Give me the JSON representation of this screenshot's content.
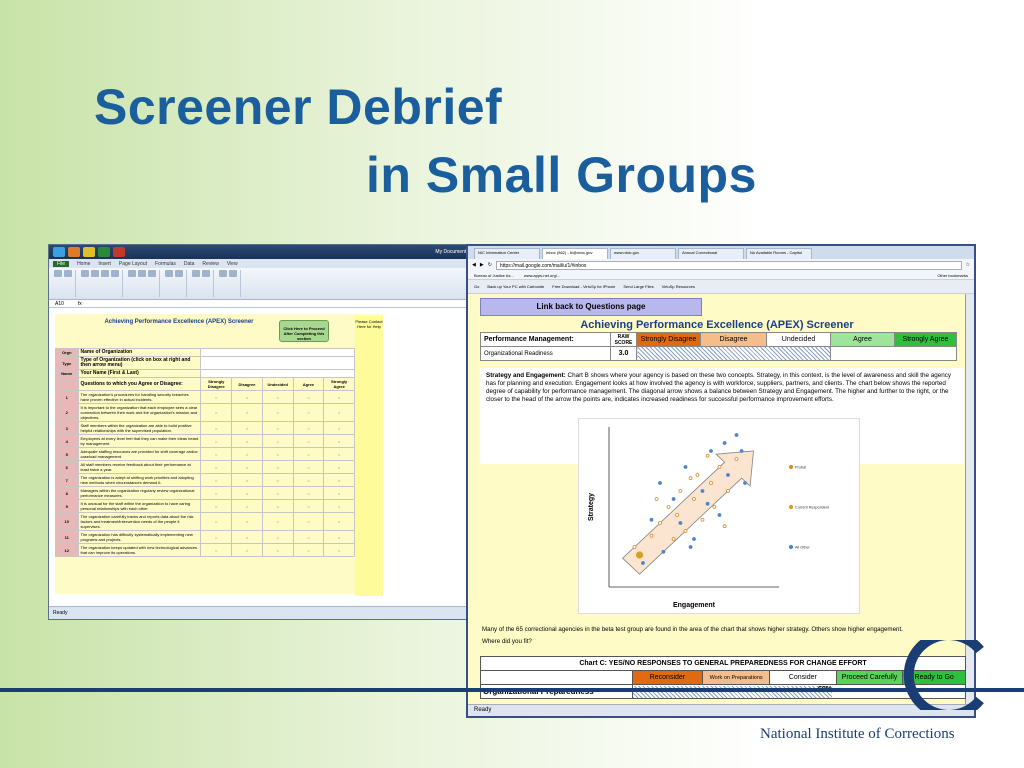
{
  "slide": {
    "title_line1": "Screener Debrief",
    "title_line2": "in Small Groups",
    "org_name": "National Institute of Corrections"
  },
  "excel": {
    "taskbar_text": "My Documents  NIC Apps  8:22 AM",
    "tabs": [
      "File",
      "Home",
      "Insert",
      "Page Layout",
      "Formulas",
      "Data",
      "Review",
      "View"
    ],
    "cell_ref": "A10",
    "headline": "Achieving Performance Excellence (APEX) Screener",
    "proceed_button": "Click Here to Proceed After Completing this section",
    "side_note": "Please Contact Here for Help",
    "info_rows": [
      {
        "code": "Orgn",
        "label": "Name of Organization"
      },
      {
        "code": "Type",
        "label": "Type of Organization (click on box at right and then arrow menu)"
      },
      {
        "code": "Name",
        "label": "Your Name (First & Last)"
      }
    ],
    "question_header": "Questions to which you Agree or Disagree:",
    "scale": [
      "Strongly Disagree",
      "Disagree",
      "Undecided",
      "Agree",
      "Strongly Agree"
    ],
    "questions": [
      {
        "n": "1",
        "text": "The organization's procedures for handling security breaches have proven effective in actual incidents."
      },
      {
        "n": "2",
        "text": "It is important to the organization that each employee sees a clear connection between their work and the organization's mission and objectives."
      },
      {
        "n": "3",
        "text": "Staff members within the organization are able to build positive helpful relationships with the supervised population."
      },
      {
        "n": "4",
        "text": "Employees at every level feel that they can make their ideas heard by management."
      },
      {
        "n": "5",
        "text": "Adequate staffing resources are provided for shift coverage and/or caseload management."
      },
      {
        "n": "6",
        "text": "All staff members receive feedback about their performance at least twice a year."
      },
      {
        "n": "7",
        "text": "The organization is adept at shifting work priorities and adopting new methods when circumstances demand it."
      },
      {
        "n": "8",
        "text": "Managers within the organization regularly review organizational performance measures."
      },
      {
        "n": "9",
        "text": "It is unusual for the staff within the organization to have caring personal relationships with each other."
      },
      {
        "n": "10",
        "text": "The organization carefully tracks and reports data about the risk factors and treatment/intervention needs of the people it supervises."
      },
      {
        "n": "11",
        "text": "The organization has difficulty systematically implementing new programs and projects."
      },
      {
        "n": "12",
        "text": "The organization keeps updated with new technological advances that can improve its operations."
      }
    ],
    "status": "Ready"
  },
  "browser": {
    "tabs": [
      "NIC Information Center",
      "Inbox (862) - lb@nicic.gov",
      "www.nicic.gov",
      "Annual Correctional",
      "No Available Rooms - Capitol"
    ],
    "url": "https://mail.google.com/mail/u/1/#inbox",
    "bookmarks": [
      "Bureau of Justice As...",
      "www.apps-net.org/...",
      "Other bookmarks"
    ],
    "toolbar": [
      "Go",
      "Back up Your PC with Carbonite",
      "Free Download - VirtuSp for iPhone",
      "Send Large Files",
      "VirtuSp Resources"
    ],
    "status": "Ready"
  },
  "apex": {
    "link_button": "Link back to Questions page",
    "title": "Achieving Performance Excellence (APEX) Screener",
    "raw_score_header": "RAW SCORE",
    "row1_label": "Performance Management:",
    "row2_label": "Organizational Readiness",
    "row2_score": "3.0",
    "scale": [
      {
        "label": "Strongly Disagree",
        "color": "#e06a10"
      },
      {
        "label": "Disagree",
        "color": "#f6bd8c"
      },
      {
        "label": "Undecided",
        "color": "#ffffff"
      },
      {
        "label": "Agree",
        "color": "#9ee49a"
      },
      {
        "label": "Strongly Agree",
        "color": "#2fbf3f"
      }
    ],
    "explain_title": "Strategy and Engagement:",
    "explain_text": "Chart B shows where your agency is based on these two concepts. Strategy, in this context, is the level of awareness and skill the agency has for planning and execution. Engagement looks at how involved the agency is with workforce, suppliers, partners, and clients. The chart below shows the reported degree of capability for performance management. The diagonal arrow shows a balance between Strategy and Engagement. The higher and further to the right, or the closer to the head of the arrow the points are, indicates increased readiness for successful performance improvement efforts.",
    "note_line1": "Many of the 65 correctional agencies in the beta test group are found in the area of the chart that shows higher strategy. Others show higher engagement.",
    "note_line2": "Where did you fit?",
    "chartc_title": "Chart C: YES/NO RESPONSES TO GENERAL PREPAREDNESS FOR CHANGE EFFORT",
    "chartc_scale": [
      {
        "label": "Reconsider",
        "color": "#e06a10"
      },
      {
        "label": "Work on Preparations",
        "color": "#f6bd8c"
      },
      {
        "label": "Consider",
        "color": "#ffffff"
      },
      {
        "label": "Proceed Carefully",
        "color": "#59d15a"
      },
      {
        "label": "Ready to Go",
        "color": "#2fbf3f"
      }
    ],
    "chartc_row_label": "Organizational Preparedness",
    "chartc_row_value": "60%"
  },
  "chart_data": {
    "type": "scatter",
    "title": "",
    "xlabel": "Engagement",
    "ylabel": "Strategy",
    "xlim": [
      0,
      10
    ],
    "ylim": [
      0,
      10
    ],
    "grid": false,
    "legend_position": "right",
    "series": [
      {
        "name": "Probat",
        "color": "#e08a2a",
        "points": [
          [
            1.5,
            2.5
          ],
          [
            2.5,
            3.2
          ],
          [
            3.0,
            4.0
          ],
          [
            3.5,
            5.0
          ],
          [
            4.0,
            4.5
          ],
          [
            4.2,
            6.0
          ],
          [
            4.5,
            3.5
          ],
          [
            5.0,
            5.5
          ],
          [
            5.2,
            7.0
          ],
          [
            5.5,
            4.2
          ],
          [
            6.0,
            6.5
          ],
          [
            6.2,
            5.0
          ],
          [
            6.5,
            7.5
          ],
          [
            6.8,
            3.8
          ],
          [
            7.0,
            6.0
          ],
          [
            7.5,
            8.0
          ],
          [
            4.8,
            6.8
          ],
          [
            3.8,
            3.0
          ],
          [
            5.8,
            8.2
          ],
          [
            2.8,
            5.5
          ]
        ]
      },
      {
        "name": "Current Respondent",
        "color": "#d8a020",
        "points": [
          [
            1.8,
            2.0
          ]
        ]
      },
      {
        "name": "All Other",
        "color": "#4a86d0",
        "points": [
          [
            2.0,
            1.5
          ],
          [
            3.2,
            2.2
          ],
          [
            3.8,
            5.5
          ],
          [
            4.5,
            7.5
          ],
          [
            5.0,
            3.0
          ],
          [
            5.5,
            6.0
          ],
          [
            6.0,
            8.5
          ],
          [
            6.5,
            4.5
          ],
          [
            7.0,
            7.0
          ],
          [
            7.5,
            9.5
          ],
          [
            8.0,
            6.5
          ],
          [
            4.2,
            4.0
          ],
          [
            5.8,
            5.2
          ],
          [
            3.0,
            6.5
          ],
          [
            6.8,
            9.0
          ],
          [
            7.8,
            8.5
          ],
          [
            2.5,
            4.2
          ],
          [
            4.8,
            2.5
          ]
        ]
      }
    ]
  }
}
